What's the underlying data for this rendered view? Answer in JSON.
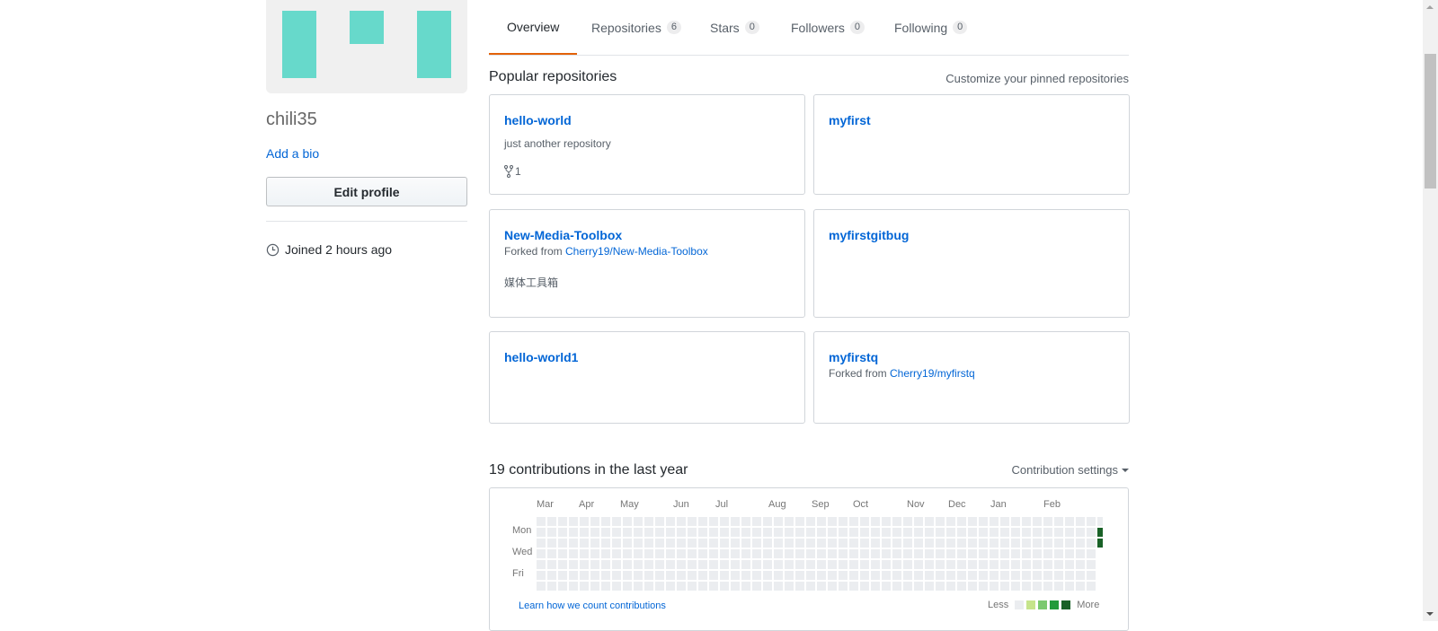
{
  "profile": {
    "username": "chili35",
    "add_bio": "Add a bio",
    "edit_profile": "Edit profile",
    "joined": "Joined 2 hours ago",
    "avatar_color": "#67d9cb"
  },
  "tabs": [
    {
      "label": "Overview",
      "count": null
    },
    {
      "label": "Repositories",
      "count": "6"
    },
    {
      "label": "Stars",
      "count": "0"
    },
    {
      "label": "Followers",
      "count": "0"
    },
    {
      "label": "Following",
      "count": "0"
    }
  ],
  "pinned": {
    "title": "Popular repositories",
    "customize": "Customize your pinned repositories",
    "repos": [
      {
        "name": "hello-world",
        "description": "just another repository",
        "forks": "1"
      },
      {
        "name": "myfirst"
      },
      {
        "name": "New-Media-Toolbox",
        "forked_prefix": "Forked from ",
        "forked_from": "Cherry19/New-Media-Toolbox",
        "description": "媒体工具箱"
      },
      {
        "name": "myfirstgitbug"
      },
      {
        "name": "hello-world1"
      },
      {
        "name": "myfirstq",
        "forked_prefix": "Forked from ",
        "forked_from": "Cherry19/myfirstq"
      }
    ]
  },
  "contributions": {
    "title": "19 contributions in the last year",
    "settings": "Contribution settings",
    "months": [
      "Mar",
      "Apr",
      "May",
      "Jun",
      "Jul",
      "Aug",
      "Sep",
      "Oct",
      "Nov",
      "Dec",
      "Jan",
      "Feb"
    ],
    "weekdays": [
      "Mon",
      "Wed",
      "Fri"
    ],
    "learn": "Learn how we count contributions",
    "legend_less": "Less",
    "legend_more": "More",
    "colors": [
      "#ebedf0",
      "#c6e48b",
      "#7bc96f",
      "#239a3b",
      "#196127"
    ],
    "active_days": [
      {
        "week": "last",
        "day": "Mon",
        "level": 4
      },
      {
        "week": "last",
        "day": "Tue",
        "level": 4
      }
    ]
  }
}
